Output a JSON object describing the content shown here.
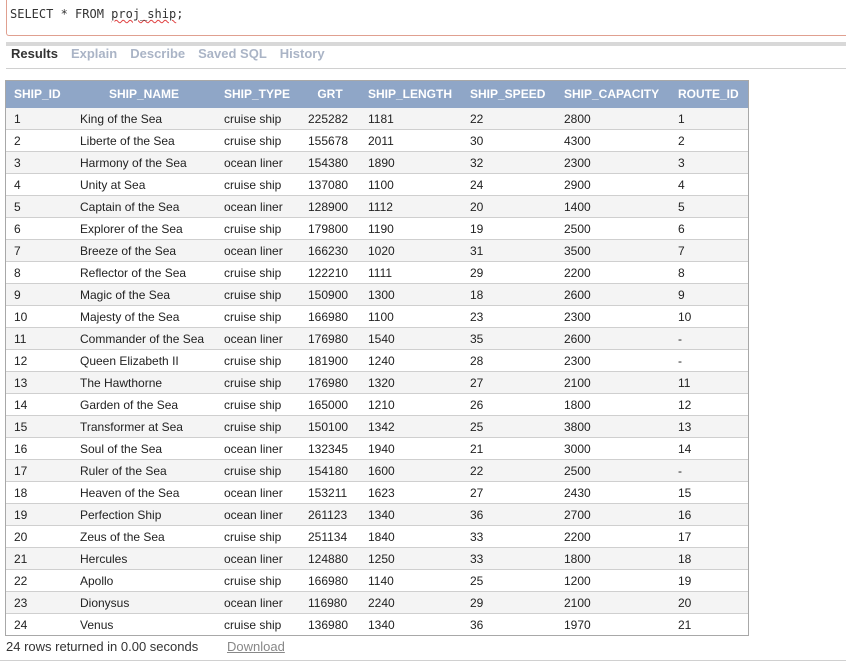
{
  "editor": {
    "sql_prefix": "SELECT * FROM ",
    "sql_table": "proj_ship",
    "sql_suffix": ";"
  },
  "tabs": [
    {
      "label": "Results",
      "active": true
    },
    {
      "label": "Explain",
      "active": false
    },
    {
      "label": "Describe",
      "active": false
    },
    {
      "label": "Saved SQL",
      "active": false
    },
    {
      "label": "History",
      "active": false
    }
  ],
  "table": {
    "columns": [
      "SHIP_ID",
      "SHIP_NAME",
      "SHIP_TYPE",
      "GRT",
      "SHIP_LENGTH",
      "SHIP_SPEED",
      "SHIP_CAPACITY",
      "ROUTE_ID"
    ],
    "rows": [
      [
        "1",
        "King of the Sea",
        "cruise ship",
        "225282",
        "1181",
        "22",
        "2800",
        "1"
      ],
      [
        "2",
        "Liberte of the Sea",
        "cruise ship",
        "155678",
        "2011",
        "30",
        "4300",
        "2"
      ],
      [
        "3",
        "Harmony of the Sea",
        "ocean liner",
        "154380",
        "1890",
        "32",
        "2300",
        "3"
      ],
      [
        "4",
        "Unity at Sea",
        "cruise ship",
        "137080",
        "1100",
        "24",
        "2900",
        "4"
      ],
      [
        "5",
        "Captain of the Sea",
        "ocean liner",
        "128900",
        "1112",
        "20",
        "1400",
        "5"
      ],
      [
        "6",
        "Explorer of the Sea",
        "cruise ship",
        "179800",
        "1190",
        "19",
        "2500",
        "6"
      ],
      [
        "7",
        "Breeze of the Sea",
        "ocean liner",
        "166230",
        "1020",
        "31",
        "3500",
        "7"
      ],
      [
        "8",
        "Reflector of the Sea",
        "cruise ship",
        "122210",
        "1111",
        "29",
        "2200",
        "8"
      ],
      [
        "9",
        "Magic of the Sea",
        "cruise ship",
        "150900",
        "1300",
        "18",
        "2600",
        "9"
      ],
      [
        "10",
        "Majesty of the Sea",
        "cruise ship",
        "166980",
        "1100",
        "23",
        "2300",
        "10"
      ],
      [
        "11",
        "Commander of the Sea",
        "ocean liner",
        "176980",
        "1540",
        "35",
        "2600",
        "-"
      ],
      [
        "12",
        "Queen Elizabeth II",
        "cruise ship",
        "181900",
        "1240",
        "28",
        "2300",
        "-"
      ],
      [
        "13",
        "The Hawthorne",
        "cruise ship",
        "176980",
        "1320",
        "27",
        "2100",
        "11"
      ],
      [
        "14",
        "Garden of the Sea",
        "cruise ship",
        "165000",
        "1210",
        "26",
        "1800",
        "12"
      ],
      [
        "15",
        "Transformer at Sea",
        "cruise ship",
        "150100",
        "1342",
        "25",
        "3800",
        "13"
      ],
      [
        "16",
        "Soul of the Sea",
        "ocean liner",
        "132345",
        "1940",
        "21",
        "3000",
        "14"
      ],
      [
        "17",
        "Ruler of the Sea",
        "cruise ship",
        "154180",
        "1600",
        "22",
        "2500",
        "-"
      ],
      [
        "18",
        "Heaven of the Sea",
        "ocean liner",
        "153211",
        "1623",
        "27",
        "2430",
        "15"
      ],
      [
        "19",
        "Perfection Ship",
        "ocean liner",
        "261123",
        "1340",
        "36",
        "2700",
        "16"
      ],
      [
        "20",
        "Zeus of the Sea",
        "cruise ship",
        "251134",
        "1840",
        "33",
        "2200",
        "17"
      ],
      [
        "21",
        "Hercules",
        "ocean liner",
        "124880",
        "1250",
        "33",
        "1800",
        "18"
      ],
      [
        "22",
        "Apollo",
        "cruise ship",
        "166980",
        "1140",
        "25",
        "1200",
        "19"
      ],
      [
        "23",
        "Dionysus",
        "ocean liner",
        "116980",
        "2240",
        "29",
        "2100",
        "20"
      ],
      [
        "24",
        "Venus",
        "cruise ship",
        "136980",
        "1340",
        "36",
        "1970",
        "21"
      ]
    ]
  },
  "footer": {
    "status": "24 rows returned in 0.00 seconds",
    "download_label": "Download"
  },
  "colors": {
    "header_bg": "#8fa6c7",
    "tab_inactive": "#aab4c6",
    "editor_border": "#e0a090"
  }
}
